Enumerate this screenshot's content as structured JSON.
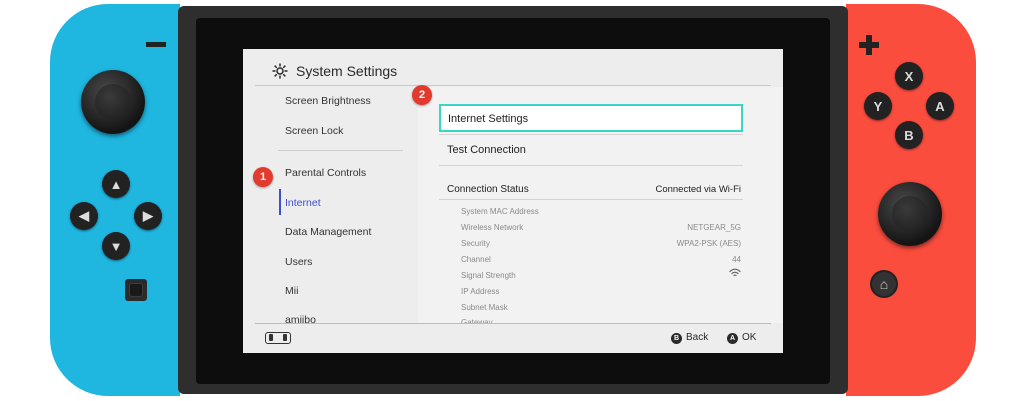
{
  "screen": {
    "title": "System Settings",
    "nav": {
      "items": [
        {
          "label": "Screen Brightness"
        },
        {
          "label": "Screen Lock"
        },
        {
          "label": "Parental Controls"
        },
        {
          "label": "Internet",
          "selected": true
        },
        {
          "label": "Data Management"
        },
        {
          "label": "Users"
        },
        {
          "label": "Mii"
        },
        {
          "label": "amiibo"
        }
      ]
    },
    "options": {
      "internet_settings": "Internet Settings",
      "test_connection": "Test Connection"
    },
    "connection": {
      "status_label": "Connection Status",
      "status_value": "Connected via Wi-Fi",
      "details": [
        {
          "key": "System MAC Address",
          "value": ""
        },
        {
          "key": "Wireless Network",
          "value": "NETGEAR_5G"
        },
        {
          "key": "Security",
          "value": "WPA2-PSK (AES)"
        },
        {
          "key": "Channel",
          "value": "44"
        },
        {
          "key": "Signal Strength",
          "value": ""
        },
        {
          "key": "IP Address",
          "value": ""
        },
        {
          "key": "Subnet Mask",
          "value": ""
        },
        {
          "key": "Gateway",
          "value": ""
        }
      ]
    },
    "footer": {
      "back_glyph": "B",
      "back_label": "Back",
      "ok_glyph": "A",
      "ok_label": "OK"
    }
  },
  "annotations": {
    "step1": "1",
    "step2": "2"
  },
  "controller": {
    "buttons": {
      "x": "X",
      "y": "Y",
      "a": "A",
      "b": "B"
    }
  },
  "colors": {
    "left_joycon": "#1fb6e0",
    "right_joycon": "#fa4d3e",
    "selection_highlight": "#39d6c8",
    "nav_selected": "#3a4fd1",
    "badge": "#e23b2e"
  }
}
